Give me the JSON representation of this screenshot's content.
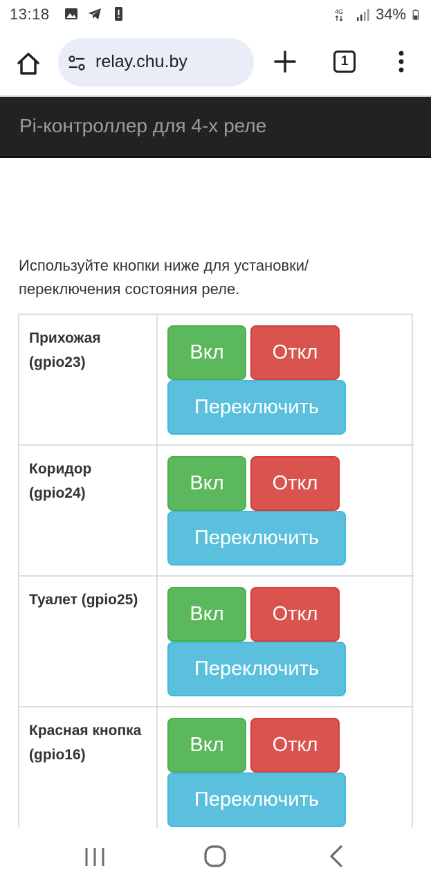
{
  "status_bar": {
    "time": "13:18",
    "battery_percent": "34%",
    "network_label": "4G",
    "icons_left": [
      "gallery-icon",
      "telegram-icon",
      "alert-icon"
    ],
    "icons_right": [
      "network-4g-icon",
      "signal-icon",
      "battery-icon"
    ]
  },
  "browser": {
    "url": "relay.chu.by",
    "tab_count": "1",
    "icons": [
      "home-icon",
      "site-settings-icon",
      "new-tab-icon",
      "tabs-icon",
      "menu-icon"
    ]
  },
  "navbar": {
    "brand": "Pi-контроллер для 4-х реле",
    "background": "#222222"
  },
  "intro_text": "Используйте кнопки ниже для установки/переключения состояния реле.",
  "relays": [
    {
      "name": "Прихожая (gpio23)",
      "on": "Вкл",
      "off": "Откл",
      "toggle": "Переключить"
    },
    {
      "name": "Коридор (gpio24)",
      "on": "Вкл",
      "off": "Откл",
      "toggle": "Переключить"
    },
    {
      "name": "Туалет (gpio25)",
      "on": "Вкл",
      "off": "Откл",
      "toggle": "Переключить"
    },
    {
      "name": "Красная кнопка (gpio16)",
      "on": "Вкл",
      "off": "Откл",
      "toggle": "Переключить"
    }
  ],
  "colors": {
    "on_button": "#5cb85c",
    "off_button": "#d9534f",
    "toggle_button": "#5bc0de"
  },
  "system_nav": [
    "recent-apps-icon",
    "home-button-icon",
    "back-icon"
  ]
}
